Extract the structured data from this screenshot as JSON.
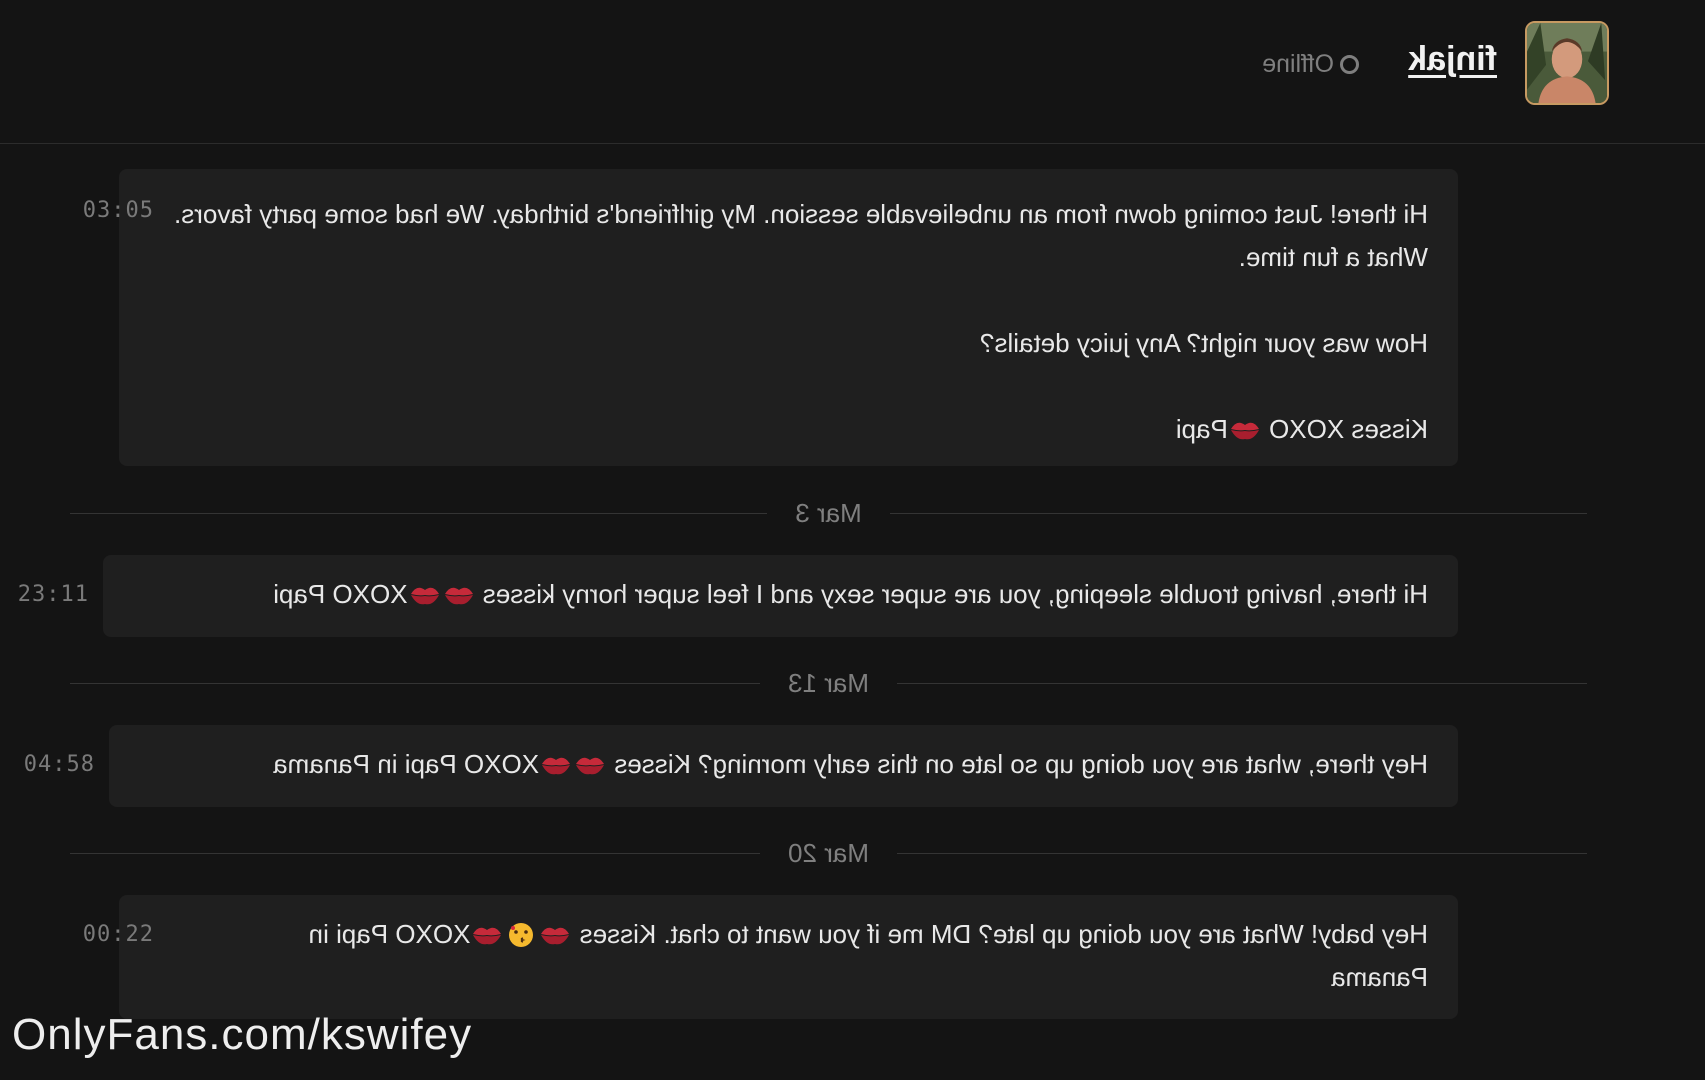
{
  "header": {
    "username": "finjak",
    "status": "Offline"
  },
  "messages": [
    {
      "time": "03:05",
      "paragraphs": [
        "Hi there! Just coming down from an unbelievable session. My girlfriend's birthday. We had some party favors. What a fun time.",
        "How was your night? Any juicy details?",
        "Kisses XOXO",
        "Papi"
      ]
    },
    {
      "date": "Mar 3",
      "time": "23:11",
      "text_before": "Hi there, having trouble sleeping, you are super sexy and I feel super horny kisses",
      "text_after": "XOXO Papi"
    },
    {
      "date": "Mar 13",
      "time": "04:58",
      "text_before": "Hey there, what are you doing up so late on this early morning? Kisses",
      "text_after": "XOXO Papi in Panama"
    },
    {
      "date": "Mar 20",
      "time": "00:22",
      "line1_before": "Hey baby! What are you doing up late? DM me if you want to chat. Kisses",
      "line1_after": "XOXO Papi in",
      "line2": "Panama"
    }
  ],
  "icons": {
    "avatar": "user-photo",
    "status": "offline-circle-icon",
    "kiss": "kiss-mark-emoji",
    "kissing_face": "kissing-face-emoji"
  },
  "colors": {
    "background": "#141414",
    "bubble": "#1f1f1f",
    "avatar_border": "#c79a62",
    "kiss": "#c62a3a"
  },
  "watermark": "OnlyFans.com/kswifey"
}
